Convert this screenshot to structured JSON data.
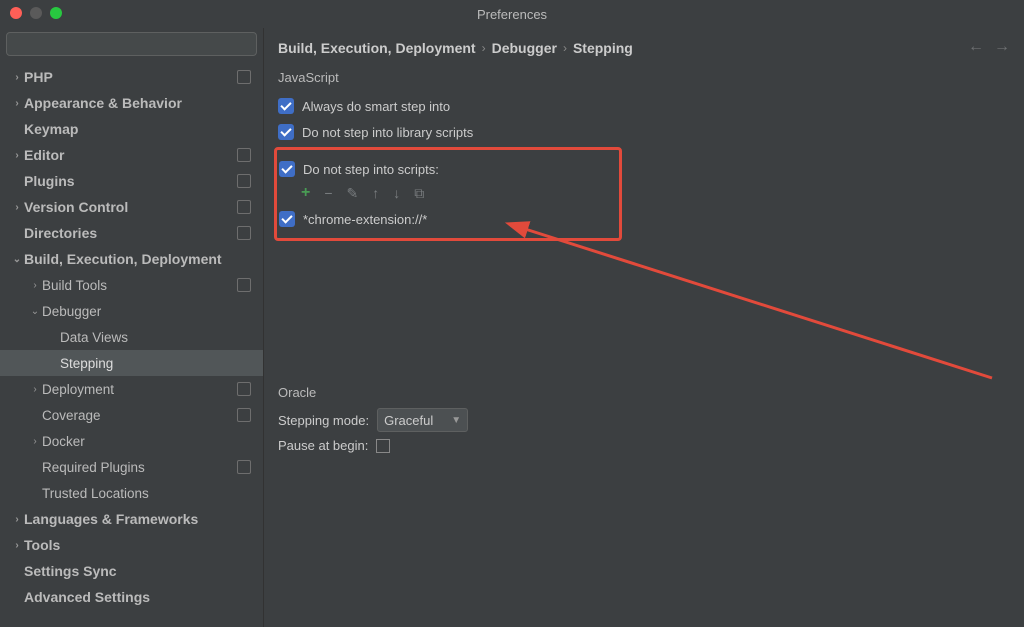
{
  "window": {
    "title": "Preferences"
  },
  "search": {
    "placeholder": ""
  },
  "sidebar": {
    "items": [
      {
        "label": "PHP",
        "level": 0,
        "chev": "›",
        "badge": true
      },
      {
        "label": "Appearance & Behavior",
        "level": 0,
        "chev": "›",
        "badge": false
      },
      {
        "label": "Keymap",
        "level": 0,
        "chev": "",
        "badge": false
      },
      {
        "label": "Editor",
        "level": 0,
        "chev": "›",
        "badge": true
      },
      {
        "label": "Plugins",
        "level": 0,
        "chev": "",
        "badge": true
      },
      {
        "label": "Version Control",
        "level": 0,
        "chev": "›",
        "badge": true
      },
      {
        "label": "Directories",
        "level": 0,
        "chev": "",
        "badge": true
      },
      {
        "label": "Build, Execution, Deployment",
        "level": 0,
        "chev": "⌄",
        "badge": false
      },
      {
        "label": "Build Tools",
        "level": 1,
        "chev": "›",
        "badge": true
      },
      {
        "label": "Debugger",
        "level": 1,
        "chev": "⌄",
        "badge": false
      },
      {
        "label": "Data Views",
        "level": 2,
        "chev": "",
        "badge": false
      },
      {
        "label": "Stepping",
        "level": 2,
        "chev": "",
        "badge": false,
        "selected": true
      },
      {
        "label": "Deployment",
        "level": 1,
        "chev": "›",
        "badge": true
      },
      {
        "label": "Coverage",
        "level": 1,
        "chev": "",
        "badge": true
      },
      {
        "label": "Docker",
        "level": 1,
        "chev": "›",
        "badge": false
      },
      {
        "label": "Required Plugins",
        "level": 1,
        "chev": "",
        "badge": true
      },
      {
        "label": "Trusted Locations",
        "level": 1,
        "chev": "",
        "badge": false
      },
      {
        "label": "Languages & Frameworks",
        "level": 0,
        "chev": "›",
        "badge": false
      },
      {
        "label": "Tools",
        "level": 0,
        "chev": "›",
        "badge": false
      },
      {
        "label": "Settings Sync",
        "level": 0,
        "chev": "",
        "badge": false
      },
      {
        "label": "Advanced Settings",
        "level": 0,
        "chev": "",
        "badge": false
      }
    ]
  },
  "breadcrumb": {
    "a": "Build, Execution, Deployment",
    "b": "Debugger",
    "c": "Stepping"
  },
  "main": {
    "js_section": "JavaScript",
    "cb1": "Always do smart step into",
    "cb2": "Do not step into library scripts",
    "cb3": "Do not step into scripts:",
    "script_entry": "*chrome-extension://*",
    "oracle_section": "Oracle",
    "stepping_mode_label": "Stepping mode:",
    "stepping_mode_value": "Graceful",
    "pause_label": "Pause at begin:"
  },
  "toolbar_icons": {
    "add": "+",
    "remove": "−",
    "edit": "✎",
    "up": "↑",
    "down": "↓",
    "copy": "⧉"
  }
}
